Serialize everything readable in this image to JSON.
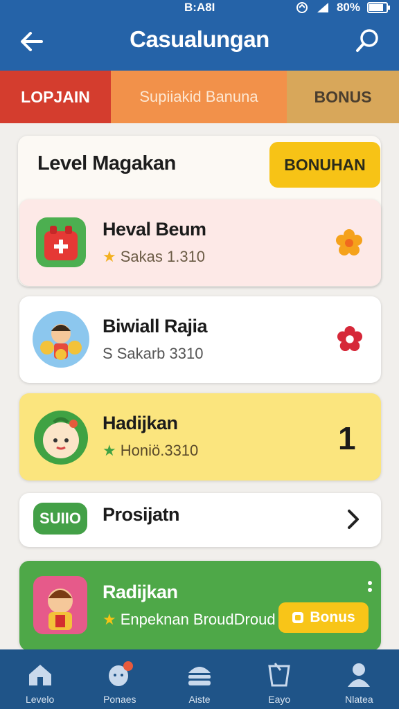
{
  "status_bar": {
    "time": "B:A8I",
    "battery": "80%"
  },
  "appbar": {
    "title": "Casualungan"
  },
  "tabs": [
    {
      "label": "LOPJAIN"
    },
    {
      "label": "Supiiakid Banuna"
    },
    {
      "label": "BONUS"
    }
  ],
  "section": {
    "title": "Level Magakan",
    "button_label": "BONUHAN"
  },
  "rows": [
    {
      "name": "Heval Beum",
      "meta": "Sakas 1.310",
      "trailing": "flower"
    },
    {
      "name": "Biwiall Rajia",
      "meta_prefix": "S",
      "meta": "Sakarb 3310",
      "trailing": "flower"
    },
    {
      "name": "Hadijkan",
      "meta": "Honiö.3310",
      "trailing_value": "1"
    },
    {
      "name": "Prosijatn",
      "badge": "SUIIO",
      "trailing": "chevron"
    },
    {
      "name": "Radijkan",
      "meta": "Enpeknan BroudDroud",
      "button_label": "Bonus"
    }
  ],
  "nav": [
    {
      "label": "Levelo"
    },
    {
      "label": "Ponaes"
    },
    {
      "label": "Aiste"
    },
    {
      "label": "Eayo"
    },
    {
      "label": "Nlatea"
    }
  ],
  "colors": {
    "primary": "#2563a8",
    "accent_yellow": "#f7c316",
    "green": "#4ea848"
  }
}
